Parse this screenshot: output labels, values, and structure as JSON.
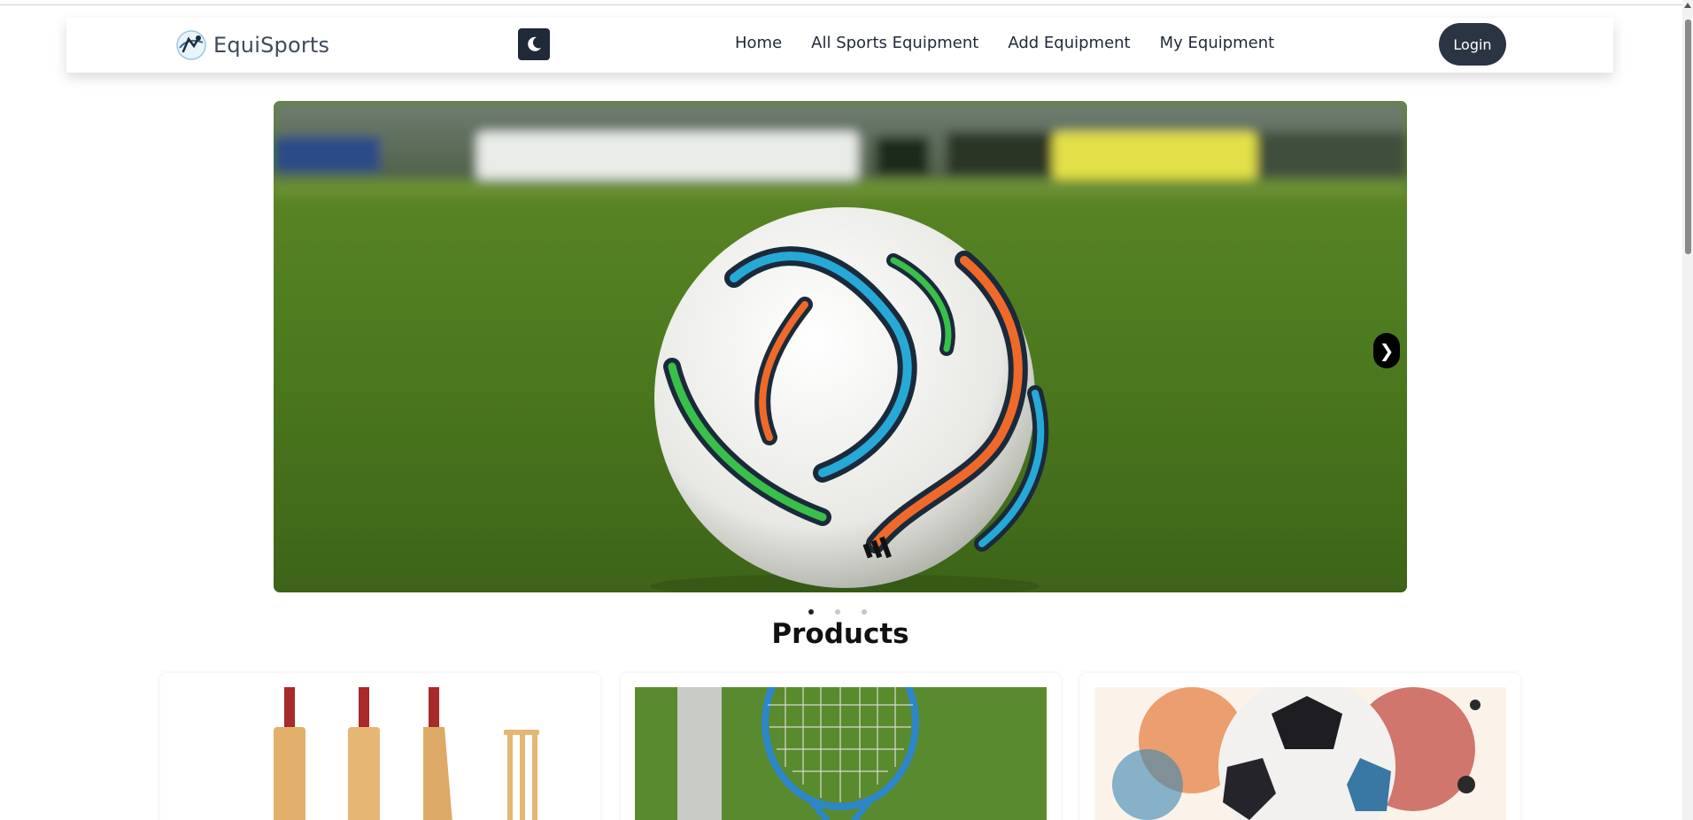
{
  "navbar": {
    "brand": "EquiSports",
    "links": [
      "Home",
      "All Sports Equipment",
      "Add Equipment",
      "My Equipment"
    ],
    "login_label": "Login",
    "theme_icon": "moon-icon"
  },
  "carousel": {
    "slide_count": 3,
    "active_index": 0,
    "next_symbol": "❯"
  },
  "products": {
    "title": "Products"
  },
  "colors": {
    "nav_dark": "#2b3442",
    "grass": "#4d7a1f"
  }
}
